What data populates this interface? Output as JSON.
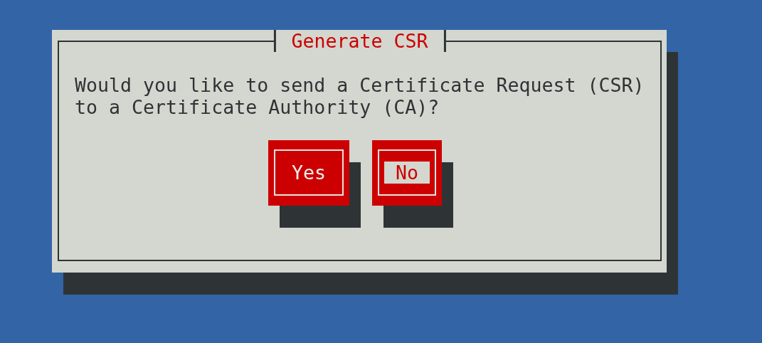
{
  "dialog": {
    "title": "Generate CSR",
    "message": "Would you like to send a Certificate Request (CSR) to a Certificate Authority (CA)?",
    "buttons": [
      {
        "label": "Yes",
        "selected": false
      },
      {
        "label": "No",
        "selected": true
      }
    ]
  }
}
